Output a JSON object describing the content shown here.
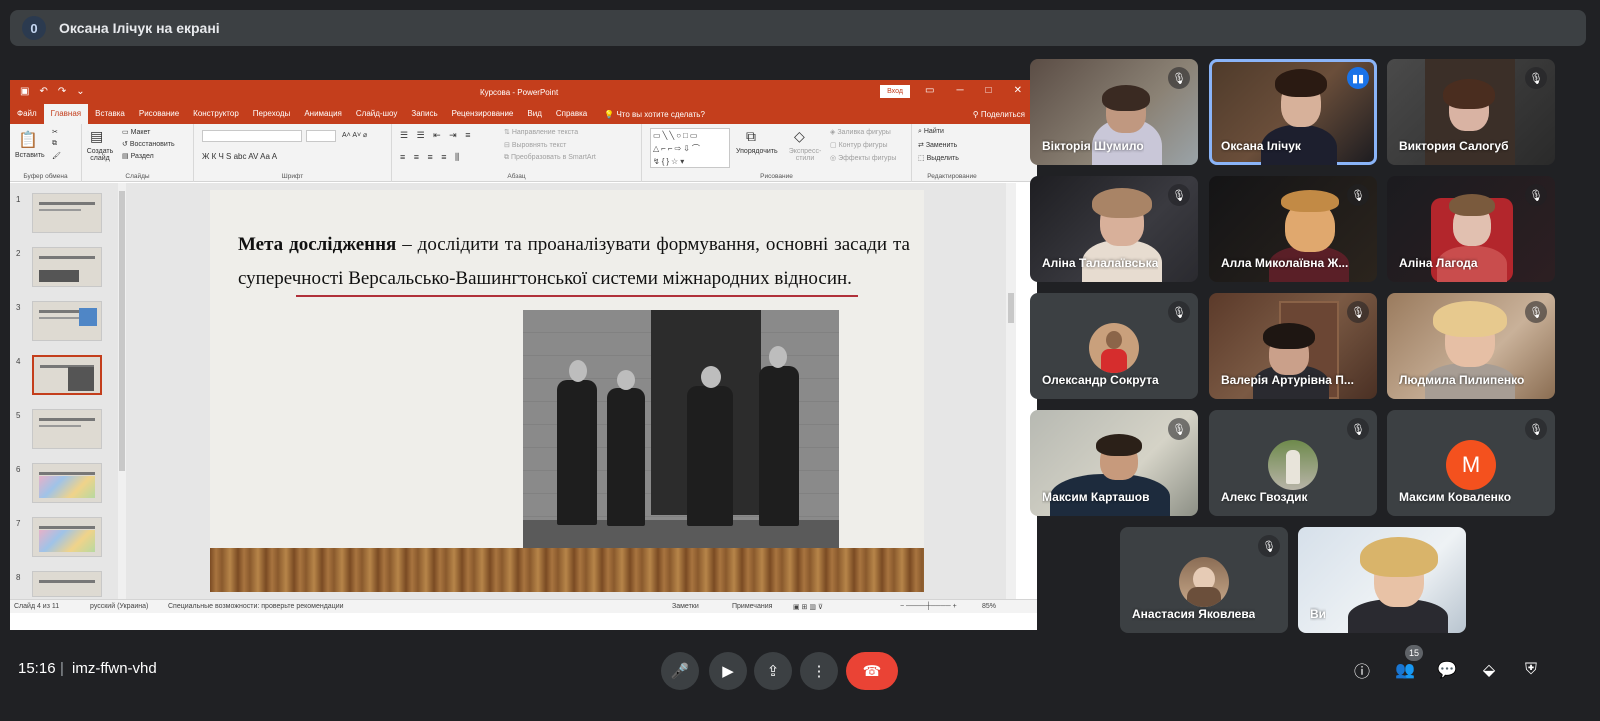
{
  "banner": {
    "count": "0",
    "text": "Оксана Ілічук на екрані"
  },
  "powerpoint": {
    "title": "Курсова - PowerPoint",
    "signin": "Вход",
    "tabs": [
      "Файл",
      "Главная",
      "Вставка",
      "Рисование",
      "Конструктор",
      "Переходы",
      "Анимация",
      "Слайд-шоу",
      "Запись",
      "Рецензирование",
      "Вид",
      "Справка"
    ],
    "active_tab": "Главная",
    "tell_me": "Что вы хотите сделать?",
    "share": "Поделиться",
    "ribbon": {
      "paste": "Вставить",
      "new_slide": "Создать слайд",
      "layout": "Макет",
      "reset": "Восстановить",
      "section": "Раздел",
      "text_direction": "Направление текста",
      "align_text": "Выровнять текст",
      "convert_smartart": "Преобразовать в SmartArt",
      "arrange": "Упорядочить",
      "quick_styles": "Экспресс-стили",
      "shape_fill": "Заливка фигуры",
      "shape_outline": "Контур фигуры",
      "shape_effects": "Эффекты фигуры",
      "find": "Найти",
      "replace": "Заменить",
      "select": "Выделить",
      "groups": {
        "clipboard": "Буфер обмена",
        "slides": "Слайды",
        "font": "Шрифт",
        "paragraph": "Абзац",
        "drawing": "Рисование",
        "editing": "Редактирование"
      },
      "font_buttons": "Ж  К  Ч  S  abc  AV  Aa  A"
    },
    "thumb_numbers": [
      "1",
      "2",
      "3",
      "4",
      "5",
      "6",
      "7",
      "8"
    ],
    "slide": {
      "bold_lead": "Мета дослідження",
      "body": " – дослідити та проаналізувати формування, основні засади та суперечності Версальсько-Вашингтонської системи міжнародних відносин."
    },
    "status": {
      "slide_of": "Слайд 4 из 11",
      "language": "русский (Украина)",
      "accessibility": "Специальные возможности: проверьте рекомендации",
      "notes": "Заметки",
      "comments": "Примечания",
      "zoom": "85%"
    }
  },
  "participants": [
    {
      "name": "Вікторія Шумило",
      "kind": "video",
      "muted": true
    },
    {
      "name": "Оксана Ілічук",
      "kind": "video",
      "muted": false,
      "speaking": true
    },
    {
      "name": "Виктория Салогуб",
      "kind": "video",
      "muted": true
    },
    {
      "name": "Аліна Талалаївська",
      "kind": "video",
      "muted": true
    },
    {
      "name": "Алла Миколаївна Ж...",
      "kind": "video",
      "muted": true
    },
    {
      "name": "Аліна Лагода",
      "kind": "video",
      "muted": true
    },
    {
      "name": "Олександр Сокрута",
      "kind": "avatar",
      "muted": true
    },
    {
      "name": "Валерія Артурівна П...",
      "kind": "video",
      "muted": true
    },
    {
      "name": "Людмила Пилипенко",
      "kind": "video",
      "muted": true
    },
    {
      "name": "Максим Карташов",
      "kind": "video",
      "muted": true
    },
    {
      "name": "Алекс Гвоздик",
      "kind": "avatar",
      "muted": true
    },
    {
      "name": "Максим Коваленко",
      "kind": "letter",
      "letter": "M",
      "muted": true
    },
    {
      "name": "Анастасия Яковлева",
      "kind": "avatar",
      "muted": true
    },
    {
      "name": "Ви",
      "kind": "video",
      "muted": false
    }
  ],
  "meeting": {
    "time": "15:16",
    "separator": "|",
    "code": "imz-ffwn-vhd",
    "participant_count": "15"
  },
  "colors": {
    "end_call": "#ea4335",
    "speaking_outline": "#8ab4f8",
    "ppt_accent": "#c43e1c"
  }
}
